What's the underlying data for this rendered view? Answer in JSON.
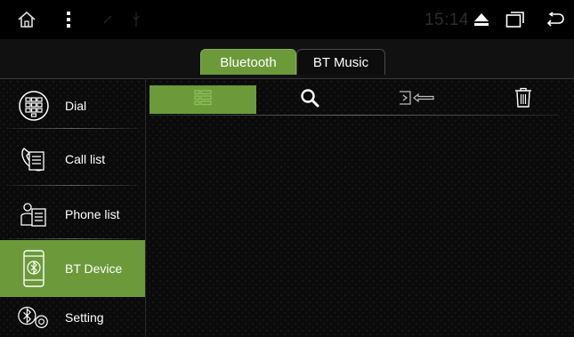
{
  "status_bar": {
    "time": "15:14",
    "icons": [
      "home-icon",
      "menu-dots-icon",
      "eject-icon",
      "recent-apps-icon",
      "back-icon"
    ]
  },
  "tabs": [
    {
      "label": "Bluetooth",
      "active": true
    },
    {
      "label": "BT Music",
      "active": false
    }
  ],
  "sidebar": {
    "items": [
      {
        "label": "Dial",
        "icon": "dialpad-icon",
        "active": false
      },
      {
        "label": "Call list",
        "icon": "call-list-icon",
        "active": false
      },
      {
        "label": "Phone list",
        "icon": "phone-list-icon",
        "active": false
      },
      {
        "label": "BT Device",
        "icon": "bt-device-icon",
        "active": true
      },
      {
        "label": "Setting",
        "icon": "bt-setting-icon",
        "active": false
      }
    ]
  },
  "toolbar": {
    "tools": [
      {
        "icon": "list-icon",
        "active": true
      },
      {
        "icon": "search-icon",
        "active": false
      },
      {
        "icon": "connect-device-icon",
        "active": false
      },
      {
        "icon": "delete-icon",
        "active": false
      }
    ]
  },
  "colors": {
    "accent": "#6c9a3a",
    "background": "#0a0a0a",
    "status_bar": "#000000"
  }
}
